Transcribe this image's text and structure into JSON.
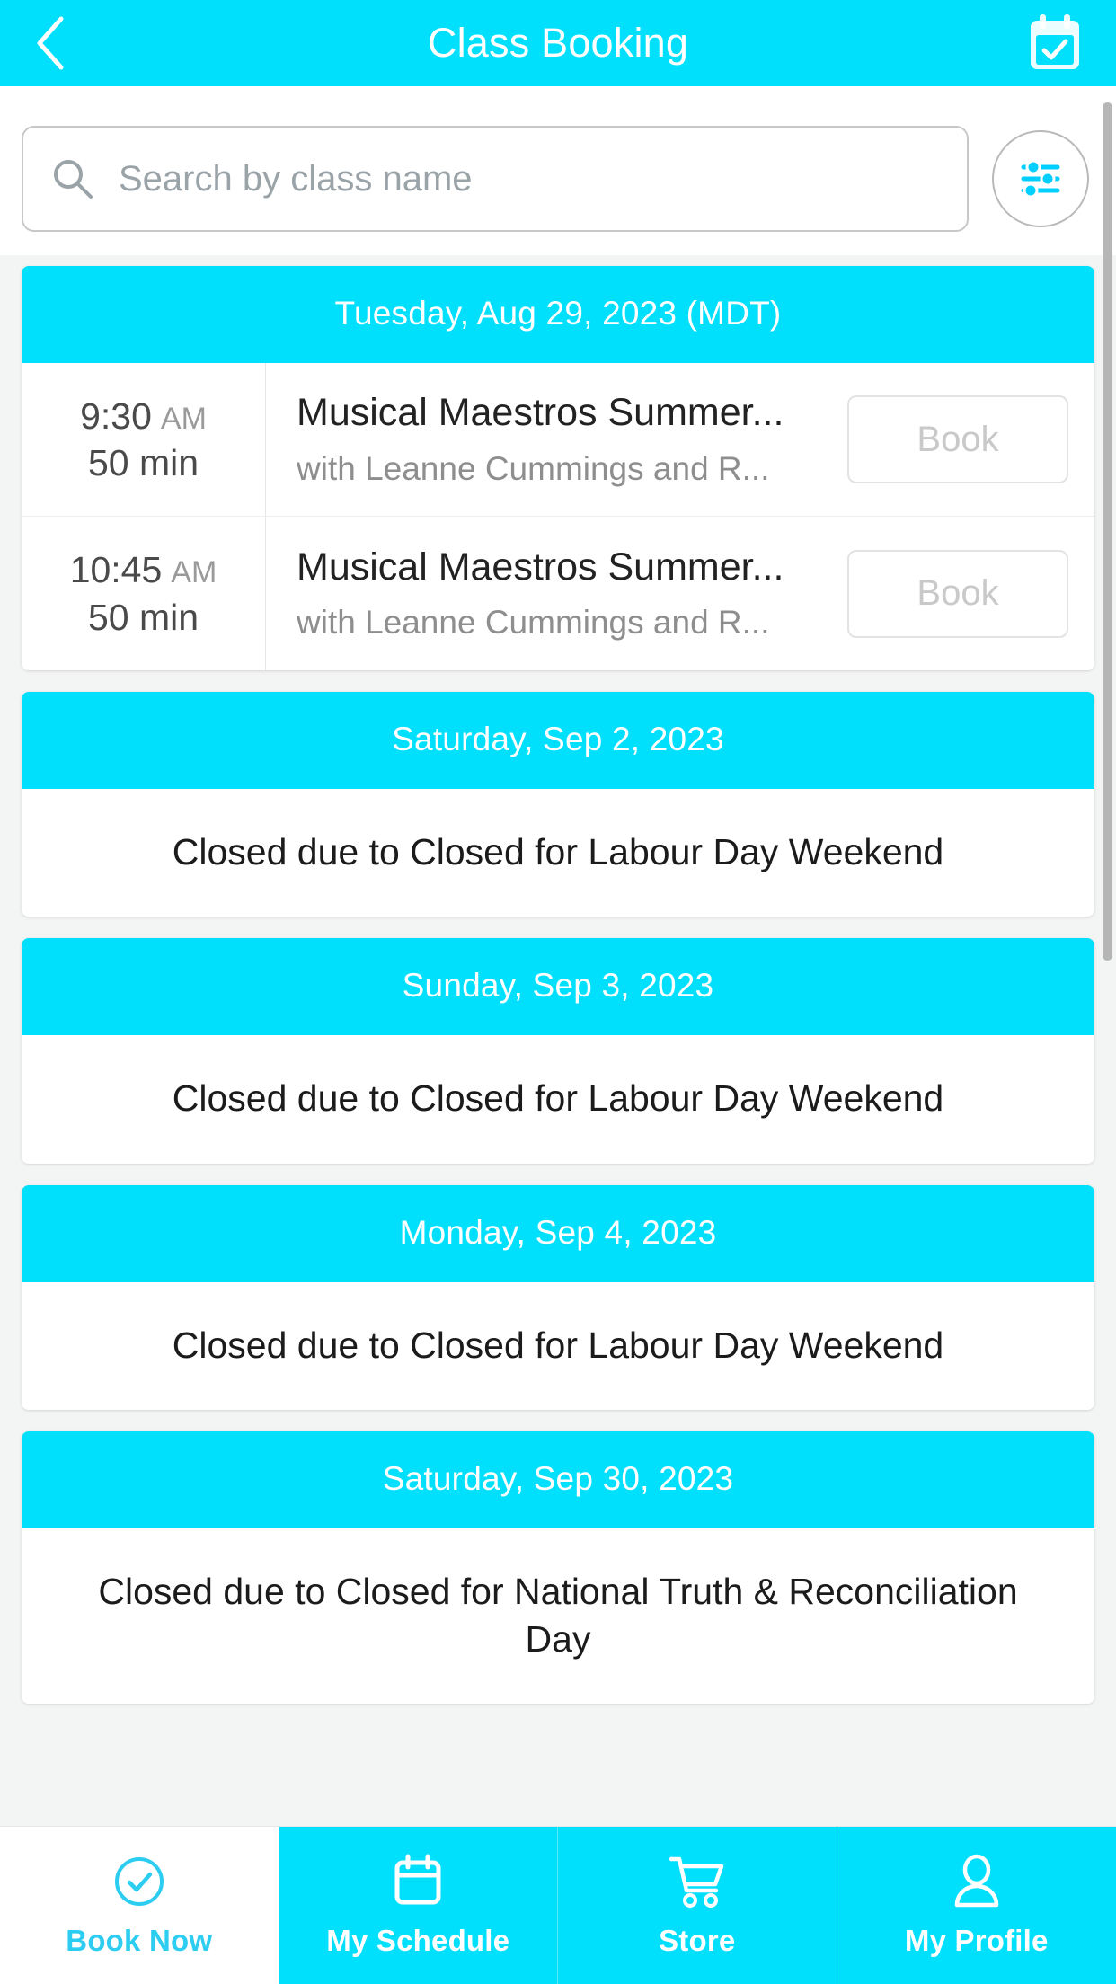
{
  "header": {
    "title": "Class Booking",
    "back_icon": "chevron-left-icon",
    "calendar_icon": "calendar-check-icon",
    "background_color": "#00DFFC"
  },
  "search": {
    "placeholder": "Search by class name",
    "value": "",
    "search_icon": "search-icon",
    "filter_icon": "sliders-filter-icon",
    "filter_icon_color": "#00CFFF"
  },
  "schedule": {
    "days": [
      {
        "date_label": "Tuesday, Aug 29, 2023 (MDT)",
        "type": "classes",
        "classes": [
          {
            "time": "9:30",
            "ampm": "AM",
            "duration": "50 min",
            "name": "Musical Maestros Summer...",
            "teacher": "with Leanne Cummings and R...",
            "action_label": "Book",
            "action_enabled": false
          },
          {
            "time": "10:45",
            "ampm": "AM",
            "duration": "50 min",
            "name": "Musical Maestros Summer...",
            "teacher": "with Leanne Cummings and R...",
            "action_label": "Book",
            "action_enabled": false
          }
        ]
      },
      {
        "date_label": "Saturday, Sep 2, 2023",
        "type": "closed",
        "closed_text": "Closed due to Closed for Labour Day Weekend"
      },
      {
        "date_label": "Sunday, Sep 3, 2023",
        "type": "closed",
        "closed_text": "Closed due to Closed for Labour Day Weekend"
      },
      {
        "date_label": "Monday, Sep 4, 2023",
        "type": "closed",
        "closed_text": "Closed due to Closed for Labour Day Weekend"
      },
      {
        "date_label": "Saturday, Sep 30, 2023",
        "type": "closed",
        "closed_text": "Closed due to Closed for National Truth & Reconciliation Day"
      }
    ]
  },
  "bottom_nav": {
    "items": [
      {
        "label": "Book Now",
        "icon": "check-circle-icon",
        "active": true
      },
      {
        "label": "My Schedule",
        "icon": "calendar-icon",
        "active": false
      },
      {
        "label": "Store",
        "icon": "shopping-cart-icon",
        "active": false
      },
      {
        "label": "My Profile",
        "icon": "user-icon",
        "active": false
      }
    ]
  },
  "colors": {
    "accent": "#00DFFC",
    "page_background": "#F3F4F4",
    "card_background": "#FFFFFF",
    "muted_text": "#8E8E8E",
    "disabled_text": "#C9C9C9"
  }
}
